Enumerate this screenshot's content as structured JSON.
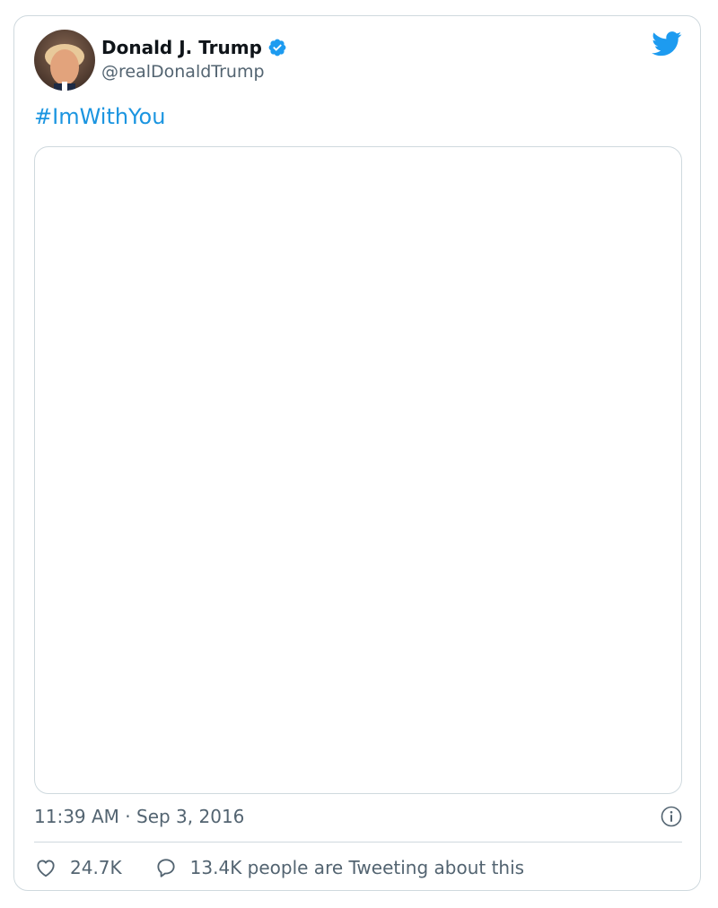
{
  "tweet": {
    "author": {
      "display_name": "Donald J. Trump",
      "handle": "@realDonaldTrump",
      "verified": true
    },
    "text": "#ImWithYou",
    "timestamp": "11:39 AM · Sep 3, 2016",
    "stats": {
      "likes": "24.7K",
      "tweeting": "13.4K people are Tweeting about this"
    }
  },
  "colors": {
    "accent": "#1d9bf0",
    "text_primary": "#0f1419",
    "text_secondary": "#536471",
    "border": "#cfd9de"
  },
  "icons": [
    "verified-badge-icon",
    "twitter-bird-icon",
    "info-icon",
    "heart-icon",
    "reply-bubble-icon"
  ]
}
